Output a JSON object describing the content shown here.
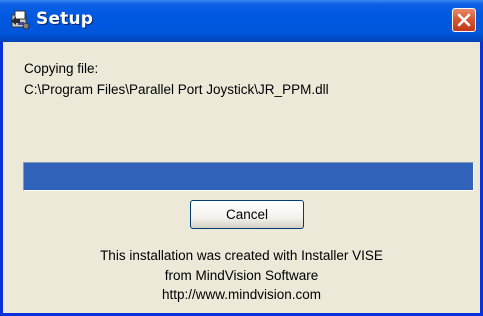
{
  "window": {
    "title": "Setup",
    "icon": "setup-installer-icon",
    "close_icon": "close-icon"
  },
  "status": {
    "label": "Copying file:",
    "file_path": "C:\\Program Files\\Parallel Port Joystick\\JR_PPM.dll"
  },
  "progress": {
    "fraction": 1.0,
    "fill_color": "#2f62b8"
  },
  "buttons": {
    "cancel_label": "Cancel"
  },
  "footer": {
    "line1": "This installation was created with Installer VISE",
    "line2": "from MindVision Software",
    "line3": "http://www.mindvision.com"
  },
  "colors": {
    "titlebar": "#0055da",
    "window_bg": "#ece9d8",
    "close_button": "#d5542e"
  }
}
